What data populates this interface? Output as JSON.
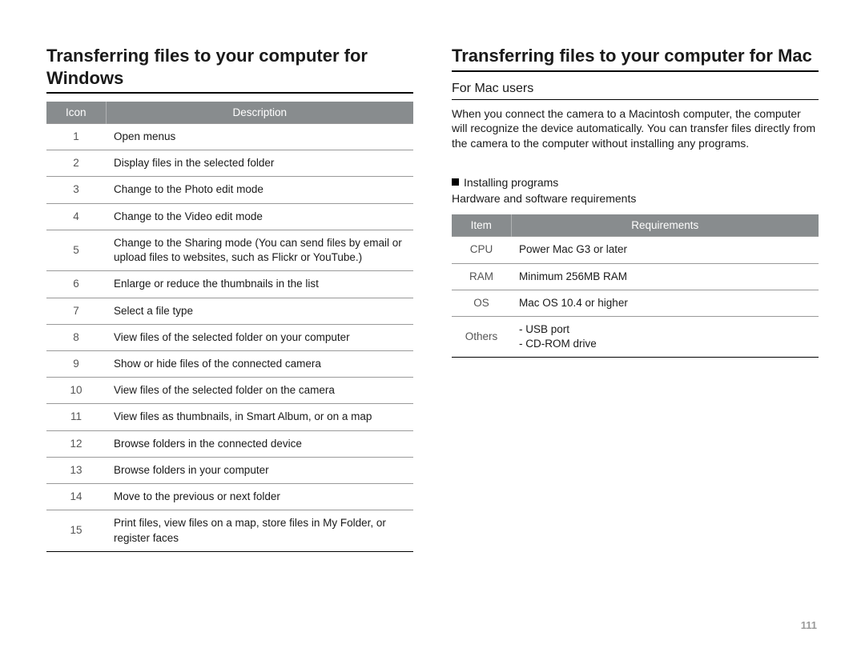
{
  "pageNumber": "111",
  "left": {
    "title": "Transferring files to your computer for Windows",
    "table": {
      "headers": [
        "Icon",
        "Description"
      ],
      "rows": [
        {
          "icon": "1",
          "desc": "Open menus"
        },
        {
          "icon": "2",
          "desc": "Display files in the selected folder"
        },
        {
          "icon": "3",
          "desc": "Change to the Photo edit mode"
        },
        {
          "icon": "4",
          "desc": "Change to the Video edit mode"
        },
        {
          "icon": "5",
          "desc": "Change to the Sharing mode (You can send files by email or upload files to websites, such as Flickr or YouTube.)"
        },
        {
          "icon": "6",
          "desc": "Enlarge or reduce the thumbnails in the list"
        },
        {
          "icon": "7",
          "desc": "Select a file type"
        },
        {
          "icon": "8",
          "desc": "View files of the selected folder on your computer"
        },
        {
          "icon": "9",
          "desc": "Show or hide files of the connected camera"
        },
        {
          "icon": "10",
          "desc": "View files of the selected folder on the camera"
        },
        {
          "icon": "11",
          "desc": "View files as thumbnails, in Smart Album, or on a map"
        },
        {
          "icon": "12",
          "desc": "Browse folders in the connected device"
        },
        {
          "icon": "13",
          "desc": "Browse folders in your computer"
        },
        {
          "icon": "14",
          "desc": "Move to the previous or next folder"
        },
        {
          "icon": "15",
          "desc": "Print files, view files on a map, store files in My Folder, or register faces"
        }
      ]
    }
  },
  "right": {
    "title": "Transferring files to your computer for Mac",
    "subheading": "For Mac users",
    "intro": "When you connect the camera to a Macintosh computer, the computer will recognize the device automatically. You can transfer files directly from the camera to the computer without installing any programs.",
    "bulletTitle": "Installing programs",
    "bulletSub": "Hardware and software requirements",
    "table": {
      "headers": [
        "Item",
        "Requirements"
      ],
      "rows": [
        {
          "item": "CPU",
          "req": "Power Mac G3 or later"
        },
        {
          "item": "RAM",
          "req": "Minimum 256MB RAM"
        },
        {
          "item": "OS",
          "req": "Mac OS 10.4 or higher"
        },
        {
          "item": "Others",
          "req": "- USB port\n- CD-ROM drive"
        }
      ]
    }
  }
}
